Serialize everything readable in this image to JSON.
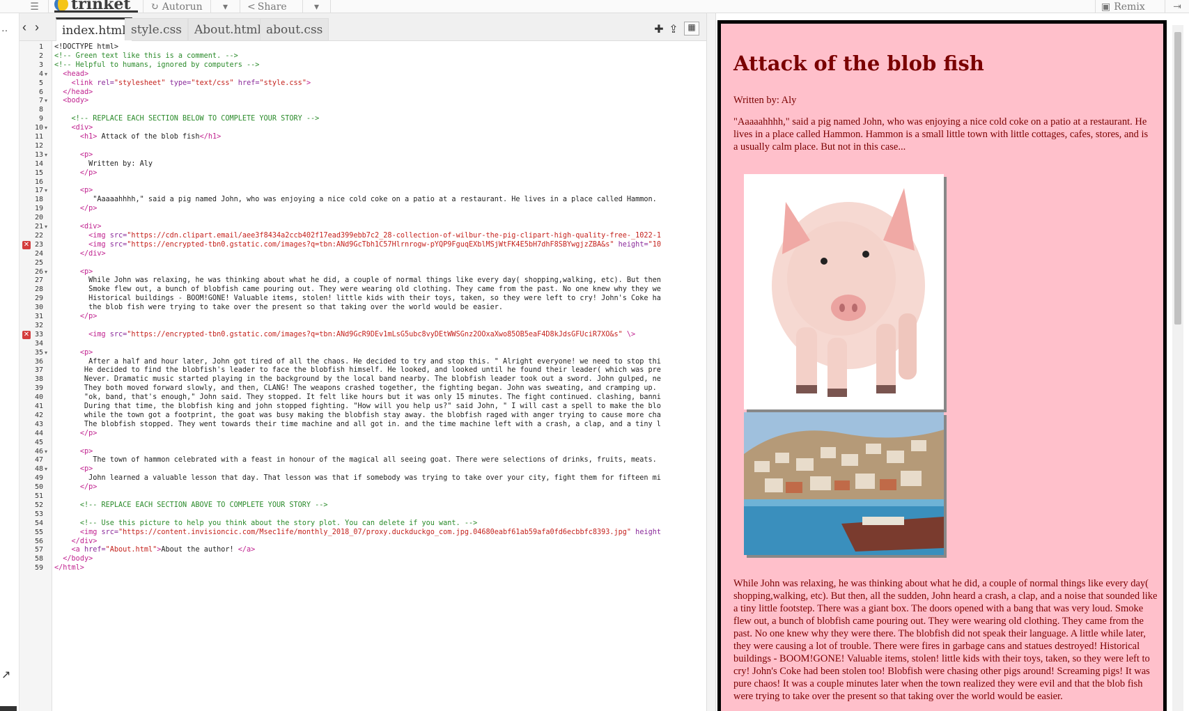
{
  "topbar": {
    "logo": "trinket",
    "autorun": "Autorun",
    "share": "Share",
    "remix": "Remix"
  },
  "tabs": [
    "index.html",
    "style.css",
    "About.html",
    "about.css"
  ],
  "editor": {
    "lines": [
      {
        "n": 1,
        "parts": [
          [
            "t",
            "<!DOCTYPE html>"
          ]
        ]
      },
      {
        "n": 2,
        "parts": [
          [
            "c",
            "<!-- Green text like this is a comment. -->"
          ]
        ]
      },
      {
        "n": 3,
        "parts": [
          [
            "c",
            "<!-- Helpful to humans, ignored by computers -->"
          ]
        ]
      },
      {
        "n": 4,
        "fold": true,
        "parts": [
          [
            "s",
            "  "
          ],
          [
            "g",
            "<head>"
          ]
        ]
      },
      {
        "n": 5,
        "parts": [
          [
            "s",
            "    "
          ],
          [
            "g",
            "<link "
          ],
          [
            "a",
            "rel="
          ],
          [
            "r",
            "\"stylesheet\""
          ],
          [
            "a",
            " type="
          ],
          [
            "r",
            "\"text/css\""
          ],
          [
            "a",
            " href="
          ],
          [
            "r",
            "\"style.css\""
          ],
          [
            "g",
            ">"
          ]
        ]
      },
      {
        "n": 6,
        "parts": [
          [
            "s",
            "  "
          ],
          [
            "g",
            "</head>"
          ]
        ]
      },
      {
        "n": 7,
        "fold": true,
        "parts": [
          [
            "s",
            "  "
          ],
          [
            "g",
            "<body>"
          ]
        ]
      },
      {
        "n": 8,
        "parts": []
      },
      {
        "n": 9,
        "parts": [
          [
            "s",
            "    "
          ],
          [
            "c",
            "<!-- REPLACE EACH SECTION BELOW TO COMPLETE YOUR STORY -->"
          ]
        ]
      },
      {
        "n": 10,
        "fold": true,
        "parts": [
          [
            "s",
            "    "
          ],
          [
            "g",
            "<div>"
          ]
        ]
      },
      {
        "n": 11,
        "parts": [
          [
            "s",
            "      "
          ],
          [
            "g",
            "<h1>"
          ],
          [
            "t",
            " Attack of the blob fish"
          ],
          [
            "g",
            "</h1>"
          ]
        ]
      },
      {
        "n": 12,
        "parts": []
      },
      {
        "n": 13,
        "fold": true,
        "parts": [
          [
            "s",
            "      "
          ],
          [
            "g",
            "<p>"
          ]
        ]
      },
      {
        "n": 14,
        "parts": [
          [
            "t",
            "        Written by: Aly"
          ]
        ]
      },
      {
        "n": 15,
        "parts": [
          [
            "s",
            "      "
          ],
          [
            "g",
            "</p>"
          ]
        ]
      },
      {
        "n": 16,
        "parts": []
      },
      {
        "n": 17,
        "fold": true,
        "parts": [
          [
            "s",
            "      "
          ],
          [
            "g",
            "<p>"
          ]
        ]
      },
      {
        "n": 18,
        "parts": [
          [
            "t",
            "         \"Aaaaahhhh,\" said a pig named John, who was enjoying a nice cold coke on a patio at a restaurant. He lives in a place called Hammon."
          ]
        ]
      },
      {
        "n": 19,
        "parts": [
          [
            "s",
            "      "
          ],
          [
            "g",
            "</p>"
          ]
        ]
      },
      {
        "n": 20,
        "parts": []
      },
      {
        "n": 21,
        "fold": true,
        "parts": [
          [
            "s",
            "      "
          ],
          [
            "g",
            "<div>"
          ]
        ]
      },
      {
        "n": 22,
        "parts": [
          [
            "s",
            "        "
          ],
          [
            "g",
            "<img "
          ],
          [
            "a",
            "src="
          ],
          [
            "r",
            "\"https://cdn.clipart.email/aee3f8434a2ccb402f17ead399ebb7c2_28-collection-of-wilbur-the-pig-clipart-high-quality-free-_1022-1"
          ]
        ]
      },
      {
        "n": 23,
        "err": true,
        "parts": [
          [
            "s",
            "        "
          ],
          [
            "g",
            "<img "
          ],
          [
            "a",
            "src="
          ],
          [
            "r",
            "\"https://encrypted-tbn0.gstatic.com/images?q=tbn:ANd9GcTbh1C57Hlrnrogw-pYQP9FguqEXblMSjWtFK4E5bH7dhF8SBYwgjzZBA&s\""
          ],
          [
            "a",
            " height="
          ],
          [
            "r",
            "\"10"
          ]
        ]
      },
      {
        "n": 24,
        "parts": [
          [
            "s",
            "      "
          ],
          [
            "g",
            "</div>"
          ]
        ]
      },
      {
        "n": 25,
        "parts": []
      },
      {
        "n": 26,
        "fold": true,
        "parts": [
          [
            "s",
            "      "
          ],
          [
            "g",
            "<p>"
          ]
        ]
      },
      {
        "n": 27,
        "parts": [
          [
            "t",
            "        While John was relaxing, he was thinking about what he did, a couple of normal things like every day( shopping,walking, etc). But then"
          ]
        ]
      },
      {
        "n": 28,
        "parts": [
          [
            "t",
            "        Smoke flew out, a bunch of blobfish came pouring out. They were wearing old clothing. They came from the past. No one knew why they we"
          ]
        ]
      },
      {
        "n": 29,
        "parts": [
          [
            "t",
            "        Historical buildings - BOOM!GONE! Valuable items, stolen! little kids with their toys, taken, so they were left to cry! John's Coke ha"
          ]
        ]
      },
      {
        "n": 30,
        "parts": [
          [
            "t",
            "        the blob fish were trying to take over the present so that taking over the world would be easier."
          ]
        ]
      },
      {
        "n": 31,
        "parts": [
          [
            "s",
            "      "
          ],
          [
            "g",
            "</p>"
          ]
        ]
      },
      {
        "n": 32,
        "parts": []
      },
      {
        "n": 33,
        "err": true,
        "parts": [
          [
            "s",
            "        "
          ],
          [
            "g",
            "<img "
          ],
          [
            "a",
            "src="
          ],
          [
            "r",
            "\"https://encrypted-tbn0.gstatic.com/images?q=tbn:ANd9GcR9DEv1mLsG5ubc8vyDEtWWSGnz2OOxaXwo85OB5eaF4D8kJdsGFUciR7XO&s\""
          ],
          [
            "g",
            " \\>"
          ]
        ]
      },
      {
        "n": 34,
        "parts": []
      },
      {
        "n": 35,
        "fold": true,
        "parts": [
          [
            "s",
            "      "
          ],
          [
            "g",
            "<p>"
          ]
        ]
      },
      {
        "n": 36,
        "parts": [
          [
            "t",
            "        After a half and hour later, John got tired of all the chaos. He decided to try and stop this. \" Alright everyone! we need to stop thi"
          ]
        ]
      },
      {
        "n": 37,
        "parts": [
          [
            "t",
            "       He decided to find the blobfish's leader to face the blobfish himself. He looked, and looked until he found their leader( which was pre"
          ]
        ]
      },
      {
        "n": 38,
        "parts": [
          [
            "t",
            "       Never. Dramatic music started playing in the background by the local band nearby. The blobfish leader took out a sword. John gulped, ne"
          ]
        ]
      },
      {
        "n": 39,
        "parts": [
          [
            "t",
            "       They both moved forward slowly, and then, CLANG! The weapons crashed together, the fighting began. John was sweating, and cramping up."
          ]
        ]
      },
      {
        "n": 40,
        "parts": [
          [
            "t",
            "       \"ok, band, that's enough,\" John said. They stopped. It felt like hours but it was only 15 minutes. The fight continued. clashing, banni"
          ]
        ]
      },
      {
        "n": 41,
        "parts": [
          [
            "t",
            "       During that time, the blobfish king and john stopped fighting. \"How will you help us?\" said John, \" I will cast a spell to make the blo"
          ]
        ]
      },
      {
        "n": 42,
        "parts": [
          [
            "t",
            "       while the town got a footprint, the goat was busy making the blobfish stay away. the blobfish raged with anger trying to cause more cha"
          ]
        ]
      },
      {
        "n": 43,
        "parts": [
          [
            "t",
            "       The blobfish stopped. They went towards their time machine and all got in. and the time machine left with a crash, a clap, and a tiny l"
          ]
        ]
      },
      {
        "n": 44,
        "parts": [
          [
            "s",
            "      "
          ],
          [
            "g",
            "</p>"
          ]
        ]
      },
      {
        "n": 45,
        "parts": []
      },
      {
        "n": 46,
        "fold": true,
        "parts": [
          [
            "s",
            "      "
          ],
          [
            "g",
            "<p>"
          ]
        ]
      },
      {
        "n": 47,
        "parts": [
          [
            "t",
            "         The town of hammon celebrated with a feast in honour of the magical all seeing goat. There were selections of drinks, fruits, meats."
          ]
        ]
      },
      {
        "n": 48,
        "fold": true,
        "parts": [
          [
            "s",
            "      "
          ],
          [
            "g",
            "<p>"
          ]
        ]
      },
      {
        "n": 49,
        "parts": [
          [
            "t",
            "        John learned a valuable lesson that day. That lesson was that if somebody was trying to take over your city, fight them for fifteen mi"
          ]
        ]
      },
      {
        "n": 50,
        "parts": [
          [
            "s",
            "      "
          ],
          [
            "g",
            "</p>"
          ]
        ]
      },
      {
        "n": 51,
        "parts": []
      },
      {
        "n": 52,
        "parts": [
          [
            "s",
            "      "
          ],
          [
            "c",
            "<!-- REPLACE EACH SECTION ABOVE TO COMPLETE YOUR STORY -->"
          ]
        ]
      },
      {
        "n": 53,
        "parts": []
      },
      {
        "n": 54,
        "parts": [
          [
            "s",
            "      "
          ],
          [
            "c",
            "<!-- Use this picture to help you think about the story plot. You can delete if you want. -->"
          ]
        ]
      },
      {
        "n": 55,
        "parts": [
          [
            "s",
            "      "
          ],
          [
            "g",
            "<img "
          ],
          [
            "a",
            "src="
          ],
          [
            "r",
            "\"https://content.invisioncic.com/Msec1ife/monthly_2018_07/proxy.duckduckgo_com.jpg.04680eabf61ab59afa0fd6ecbbfc8393.jpg\""
          ],
          [
            "a",
            " height"
          ]
        ]
      },
      {
        "n": 56,
        "parts": [
          [
            "s",
            "    "
          ],
          [
            "g",
            "</div>"
          ]
        ]
      },
      {
        "n": 57,
        "parts": [
          [
            "s",
            "    "
          ],
          [
            "g",
            "<a "
          ],
          [
            "a",
            "href="
          ],
          [
            "r",
            "\"About.html\""
          ],
          [
            "g",
            ">"
          ],
          [
            "t",
            "About the author! "
          ],
          [
            "g",
            "</a>"
          ]
        ]
      },
      {
        "n": 58,
        "parts": [
          [
            "s",
            "  "
          ],
          [
            "g",
            "</body>"
          ]
        ]
      },
      {
        "n": 59,
        "parts": [
          [
            "g",
            "</html>"
          ]
        ]
      }
    ]
  },
  "preview": {
    "title": "Attack of the blob fish",
    "author": "Written by: Aly",
    "para1": "\"Aaaaahhhh,\" said a pig named John, who was enjoying a nice cold coke on a patio at a restaurant. He lives in a place called Hammon. Hammon is a small little town with little cottages, cafes, stores, and is a usually calm place. But not in this case...",
    "para2": "While John was relaxing, he was thinking about what he did, a couple of normal things like every day( shopping,walking, etc). But then, all the sudden, John heard a crash, a clap, and a noise that sounded like a tiny little footstep. There was a giant box. The doors opened with a bang that was very loud. Smoke flew out, a bunch of blobfish came pouring out. They were wearing old clothing. They came from the past. No one knew why they were there. The blobfish did not speak their language. A little while later, they were causing a lot of trouble. There were fires in garbage cans and statues destroyed! Historical buildings - BOOM!GONE! Valuable items, stolen! little kids with their toys, taken, so they were left to cry! John's Coke had been stolen too! Blobfish were chasing other pigs around! Screaming pigs! It was pure chaos! It was a couple minutes later when the town realized they were evil and that the blob fish were trying to take over the present so that taking over the world would be easier."
  },
  "colors": {
    "preview_bg": "#ffc0cb",
    "preview_text": "#7a0000",
    "comment": "#2a8a2a",
    "tag": "#c0228f",
    "string": "#c4221d"
  }
}
